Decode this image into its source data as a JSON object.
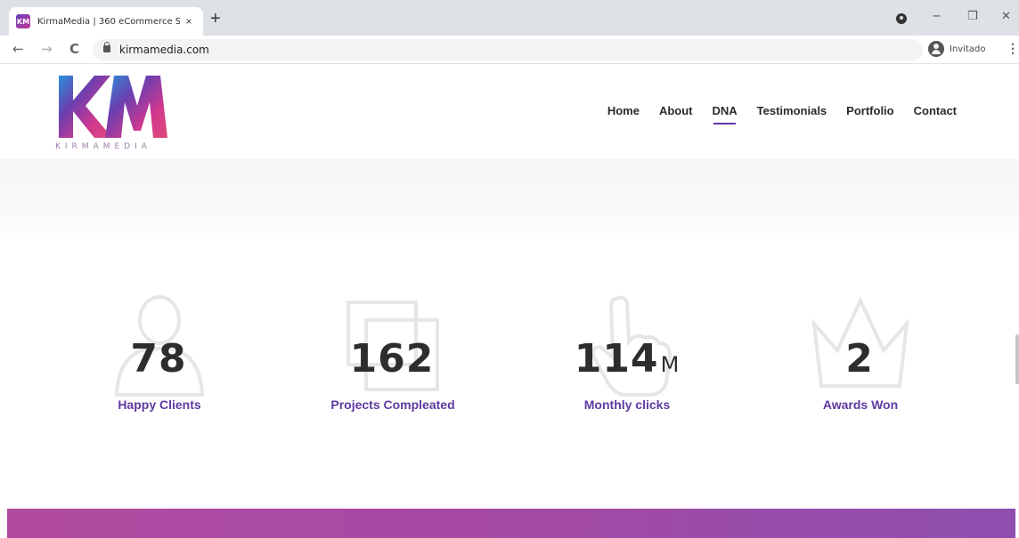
{
  "browser": {
    "tab_title": "KirmaMedia | 360 eCommerce S",
    "favicon_text": "KM",
    "close_glyph": "×",
    "newtab_glyph": "+",
    "url": "kirmamedia.com",
    "profile_label": "Invitado",
    "back_glyph": "←",
    "forward_glyph": "→",
    "reload_glyph": "C",
    "minimize_glyph": "−",
    "restore_glyph": "❐",
    "winclose_glyph": "✕",
    "menu_glyph": "⋮"
  },
  "site": {
    "brand_wordmark": "KIRMAMEDIA",
    "nav": [
      "Home",
      "About",
      "DNA",
      "Testimonials",
      "Portfolio",
      "Contact"
    ],
    "active_nav": "DNA",
    "accent": "#5e3aa0"
  },
  "stats": [
    {
      "value": "78",
      "suffix": "",
      "label": "Happy Clients",
      "icon": "user-icon"
    },
    {
      "value": "162",
      "suffix": "",
      "label": "Projects Compleated",
      "icon": "projects-icon"
    },
    {
      "value": "114",
      "suffix": "M",
      "label": "Monthly clicks",
      "icon": "hand-pointer-icon"
    },
    {
      "value": "2",
      "suffix": "",
      "label": "Awards Won",
      "icon": "crown-icon"
    }
  ]
}
